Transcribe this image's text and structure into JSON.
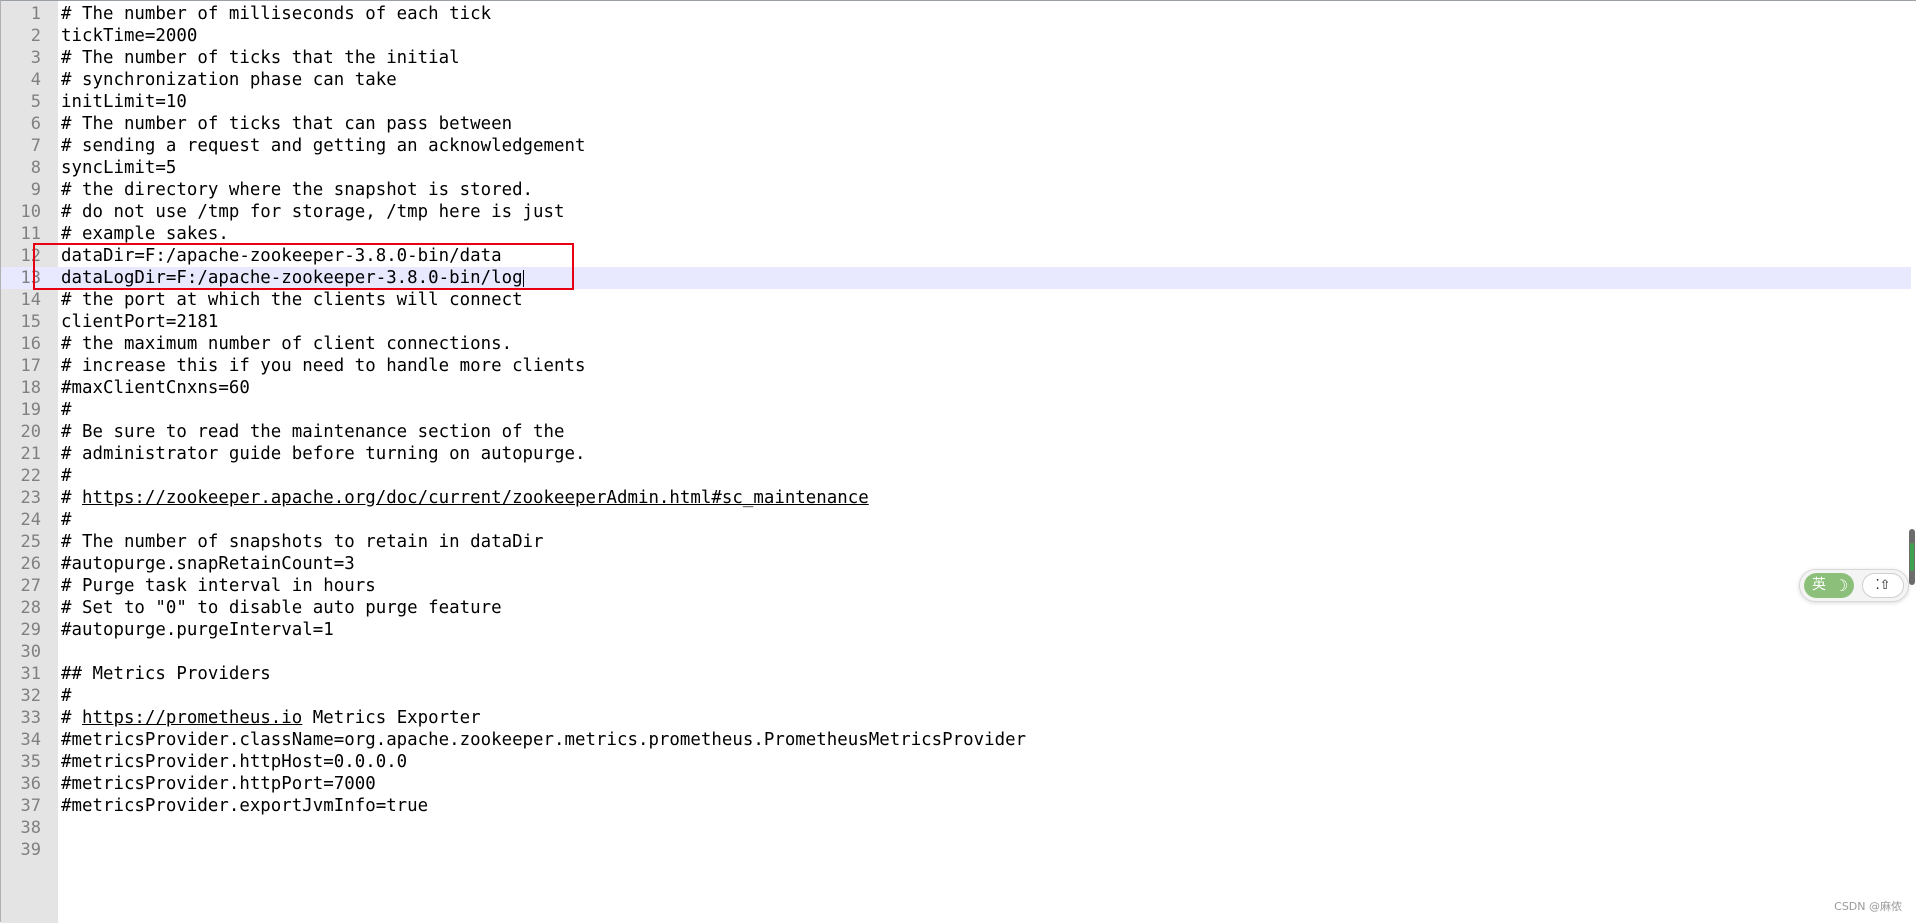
{
  "editor": {
    "current_line": 13,
    "caret_after_line": 13,
    "lines": [
      {
        "num": "1",
        "text": "# The number of milliseconds of each tick"
      },
      {
        "num": "2",
        "text": "tickTime=2000"
      },
      {
        "num": "3",
        "text": "# The number of ticks that the initial"
      },
      {
        "num": "4",
        "text": "# synchronization phase can take"
      },
      {
        "num": "5",
        "text": "initLimit=10"
      },
      {
        "num": "6",
        "text": "# The number of ticks that can pass between"
      },
      {
        "num": "7",
        "text": "# sending a request and getting an acknowledgement"
      },
      {
        "num": "8",
        "text": "syncLimit=5"
      },
      {
        "num": "9",
        "text": "# the directory where the snapshot is stored."
      },
      {
        "num": "10",
        "text": "# do not use /tmp for storage, /tmp here is just"
      },
      {
        "num": "11",
        "text": "# example sakes."
      },
      {
        "num": "12",
        "text": "dataDir=F:/apache-zookeeper-3.8.0-bin/data"
      },
      {
        "num": "13",
        "text": "dataLogDir=F:/apache-zookeeper-3.8.0-bin/log"
      },
      {
        "num": "14",
        "text": "# the port at which the clients will connect"
      },
      {
        "num": "15",
        "text": "clientPort=2181"
      },
      {
        "num": "16",
        "text": "# the maximum number of client connections."
      },
      {
        "num": "17",
        "text": "# increase this if you need to handle more clients"
      },
      {
        "num": "18",
        "text": "#maxClientCnxns=60"
      },
      {
        "num": "19",
        "text": "#"
      },
      {
        "num": "20",
        "text": "# Be sure to read the maintenance section of the"
      },
      {
        "num": "21",
        "text": "# administrator guide before turning on autopurge."
      },
      {
        "num": "22",
        "text": "#"
      },
      {
        "num": "23",
        "text": "# ",
        "link": "https://zookeeper.apache.org/doc/current/zookeeperAdmin.html#sc_maintenance",
        "after": ""
      },
      {
        "num": "24",
        "text": "#"
      },
      {
        "num": "25",
        "text": "# The number of snapshots to retain in dataDir"
      },
      {
        "num": "26",
        "text": "#autopurge.snapRetainCount=3"
      },
      {
        "num": "27",
        "text": "# Purge task interval in hours"
      },
      {
        "num": "28",
        "text": "# Set to \"0\" to disable auto purge feature"
      },
      {
        "num": "29",
        "text": "#autopurge.purgeInterval=1"
      },
      {
        "num": "30",
        "text": ""
      },
      {
        "num": "31",
        "text": "## Metrics Providers"
      },
      {
        "num": "32",
        "text": "#"
      },
      {
        "num": "33",
        "text": "# ",
        "link": "https://prometheus.io",
        "after": " Metrics Exporter"
      },
      {
        "num": "34",
        "text": "#metricsProvider.className=org.apache.zookeeper.metrics.prometheus.PrometheusMetricsProvider"
      },
      {
        "num": "35",
        "text": "#metricsProvider.httpHost=0.0.0.0"
      },
      {
        "num": "36",
        "text": "#metricsProvider.httpPort=7000"
      },
      {
        "num": "37",
        "text": "#metricsProvider.exportJvmInfo=true"
      },
      {
        "num": "38",
        "text": ""
      },
      {
        "num": "39",
        "text": ""
      }
    ]
  },
  "highlight": {
    "lines": [
      12,
      13
    ],
    "color": "#e60012"
  },
  "ime_toolbar": {
    "mode_label": "英",
    "moon_glyph": "☽",
    "right_glyph": "⁚⇧"
  },
  "watermark": "CSDN @麻侬",
  "colors": {
    "gutter_bg": "#e4e4e4",
    "current_line_bg": "#e8e8ff",
    "highlight_border": "#e60012"
  }
}
